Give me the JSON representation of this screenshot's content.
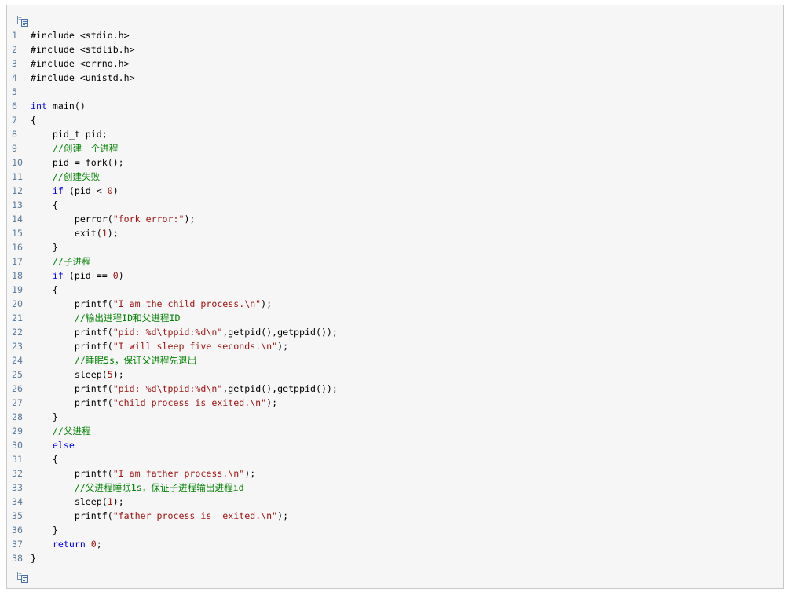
{
  "toolbar": {
    "copy_icon": "copy-icon"
  },
  "colors": {
    "keyword": "#0000ff",
    "comment": "#008000",
    "string": "#a31515",
    "number": "#a31515",
    "line_number": "#5c7c9b",
    "background": "#f6f6f6",
    "border": "#c8c8c8"
  },
  "lines": [
    {
      "n": "1",
      "tokens": [
        {
          "t": "pp",
          "v": "#include <stdio.h>"
        }
      ]
    },
    {
      "n": "2",
      "tokens": [
        {
          "t": "pp",
          "v": "#include <stdlib.h>"
        }
      ]
    },
    {
      "n": "3",
      "tokens": [
        {
          "t": "pp",
          "v": "#include <errno.h>"
        }
      ]
    },
    {
      "n": "4",
      "tokens": [
        {
          "t": "pp",
          "v": "#include <unistd.h>"
        }
      ]
    },
    {
      "n": "5",
      "tokens": []
    },
    {
      "n": "6",
      "tokens": [
        {
          "t": "kw",
          "v": "int"
        },
        {
          "t": "pl",
          "v": " main()"
        }
      ]
    },
    {
      "n": "7",
      "tokens": [
        {
          "t": "pl",
          "v": "{"
        }
      ]
    },
    {
      "n": "8",
      "tokens": [
        {
          "t": "pl",
          "v": "    pid_t pid;"
        }
      ]
    },
    {
      "n": "9",
      "tokens": [
        {
          "t": "pl",
          "v": "    "
        },
        {
          "t": "cm",
          "v": "//创建一个进程"
        }
      ]
    },
    {
      "n": "10",
      "tokens": [
        {
          "t": "pl",
          "v": "    pid = fork();"
        }
      ]
    },
    {
      "n": "11",
      "tokens": [
        {
          "t": "pl",
          "v": "    "
        },
        {
          "t": "cm",
          "v": "//创建失败"
        }
      ]
    },
    {
      "n": "12",
      "tokens": [
        {
          "t": "pl",
          "v": "    "
        },
        {
          "t": "kw",
          "v": "if"
        },
        {
          "t": "pl",
          "v": " (pid < "
        },
        {
          "t": "num",
          "v": "0"
        },
        {
          "t": "pl",
          "v": ")"
        }
      ]
    },
    {
      "n": "13",
      "tokens": [
        {
          "t": "pl",
          "v": "    {"
        }
      ]
    },
    {
      "n": "14",
      "tokens": [
        {
          "t": "pl",
          "v": "        perror("
        },
        {
          "t": "str",
          "v": "\"fork error:\""
        },
        {
          "t": "pl",
          "v": ");"
        }
      ]
    },
    {
      "n": "15",
      "tokens": [
        {
          "t": "pl",
          "v": "        exit("
        },
        {
          "t": "num",
          "v": "1"
        },
        {
          "t": "pl",
          "v": ");"
        }
      ]
    },
    {
      "n": "16",
      "tokens": [
        {
          "t": "pl",
          "v": "    }"
        }
      ]
    },
    {
      "n": "17",
      "tokens": [
        {
          "t": "pl",
          "v": "    "
        },
        {
          "t": "cm",
          "v": "//子进程"
        }
      ]
    },
    {
      "n": "18",
      "tokens": [
        {
          "t": "pl",
          "v": "    "
        },
        {
          "t": "kw",
          "v": "if"
        },
        {
          "t": "pl",
          "v": " (pid == "
        },
        {
          "t": "num",
          "v": "0"
        },
        {
          "t": "pl",
          "v": ")"
        }
      ]
    },
    {
      "n": "19",
      "tokens": [
        {
          "t": "pl",
          "v": "    {"
        }
      ]
    },
    {
      "n": "20",
      "tokens": [
        {
          "t": "pl",
          "v": "        printf("
        },
        {
          "t": "str",
          "v": "\"I am the child process.\\n\""
        },
        {
          "t": "pl",
          "v": ");"
        }
      ]
    },
    {
      "n": "21",
      "tokens": [
        {
          "t": "pl",
          "v": "        "
        },
        {
          "t": "cm",
          "v": "//输出进程ID和父进程ID"
        }
      ]
    },
    {
      "n": "22",
      "tokens": [
        {
          "t": "pl",
          "v": "        printf("
        },
        {
          "t": "str",
          "v": "\"pid: %d\\tppid:%d\\n\""
        },
        {
          "t": "pl",
          "v": ",getpid(),getppid());"
        }
      ]
    },
    {
      "n": "23",
      "tokens": [
        {
          "t": "pl",
          "v": "        printf("
        },
        {
          "t": "str",
          "v": "\"I will sleep five seconds.\\n\""
        },
        {
          "t": "pl",
          "v": ");"
        }
      ]
    },
    {
      "n": "24",
      "tokens": [
        {
          "t": "pl",
          "v": "        "
        },
        {
          "t": "cm",
          "v": "//睡眠5s，保证父进程先退出"
        }
      ]
    },
    {
      "n": "25",
      "tokens": [
        {
          "t": "pl",
          "v": "        sleep("
        },
        {
          "t": "num",
          "v": "5"
        },
        {
          "t": "pl",
          "v": ");"
        }
      ]
    },
    {
      "n": "26",
      "tokens": [
        {
          "t": "pl",
          "v": "        printf("
        },
        {
          "t": "str",
          "v": "\"pid: %d\\tppid:%d\\n\""
        },
        {
          "t": "pl",
          "v": ",getpid(),getppid());"
        }
      ]
    },
    {
      "n": "27",
      "tokens": [
        {
          "t": "pl",
          "v": "        printf("
        },
        {
          "t": "str",
          "v": "\"child process is exited.\\n\""
        },
        {
          "t": "pl",
          "v": ");"
        }
      ]
    },
    {
      "n": "28",
      "tokens": [
        {
          "t": "pl",
          "v": "    }"
        }
      ]
    },
    {
      "n": "29",
      "tokens": [
        {
          "t": "pl",
          "v": "    "
        },
        {
          "t": "cm",
          "v": "//父进程"
        }
      ]
    },
    {
      "n": "30",
      "tokens": [
        {
          "t": "pl",
          "v": "    "
        },
        {
          "t": "kw",
          "v": "else"
        }
      ]
    },
    {
      "n": "31",
      "tokens": [
        {
          "t": "pl",
          "v": "    {"
        }
      ]
    },
    {
      "n": "32",
      "tokens": [
        {
          "t": "pl",
          "v": "        printf("
        },
        {
          "t": "str",
          "v": "\"I am father process.\\n\""
        },
        {
          "t": "pl",
          "v": ");"
        }
      ]
    },
    {
      "n": "33",
      "tokens": [
        {
          "t": "pl",
          "v": "        "
        },
        {
          "t": "cm",
          "v": "//父进程睡眠1s，保证子进程输出进程id"
        }
      ]
    },
    {
      "n": "34",
      "tokens": [
        {
          "t": "pl",
          "v": "        sleep("
        },
        {
          "t": "num",
          "v": "1"
        },
        {
          "t": "pl",
          "v": ");"
        }
      ]
    },
    {
      "n": "35",
      "tokens": [
        {
          "t": "pl",
          "v": "        printf("
        },
        {
          "t": "str",
          "v": "\"father process is  exited.\\n\""
        },
        {
          "t": "pl",
          "v": ");"
        }
      ]
    },
    {
      "n": "36",
      "tokens": [
        {
          "t": "pl",
          "v": "    }"
        }
      ]
    },
    {
      "n": "37",
      "tokens": [
        {
          "t": "pl",
          "v": "    "
        },
        {
          "t": "kw",
          "v": "return"
        },
        {
          "t": "pl",
          "v": " "
        },
        {
          "t": "num",
          "v": "0"
        },
        {
          "t": "pl",
          "v": ";"
        }
      ]
    },
    {
      "n": "38",
      "tokens": [
        {
          "t": "pl",
          "v": "}"
        }
      ]
    }
  ]
}
